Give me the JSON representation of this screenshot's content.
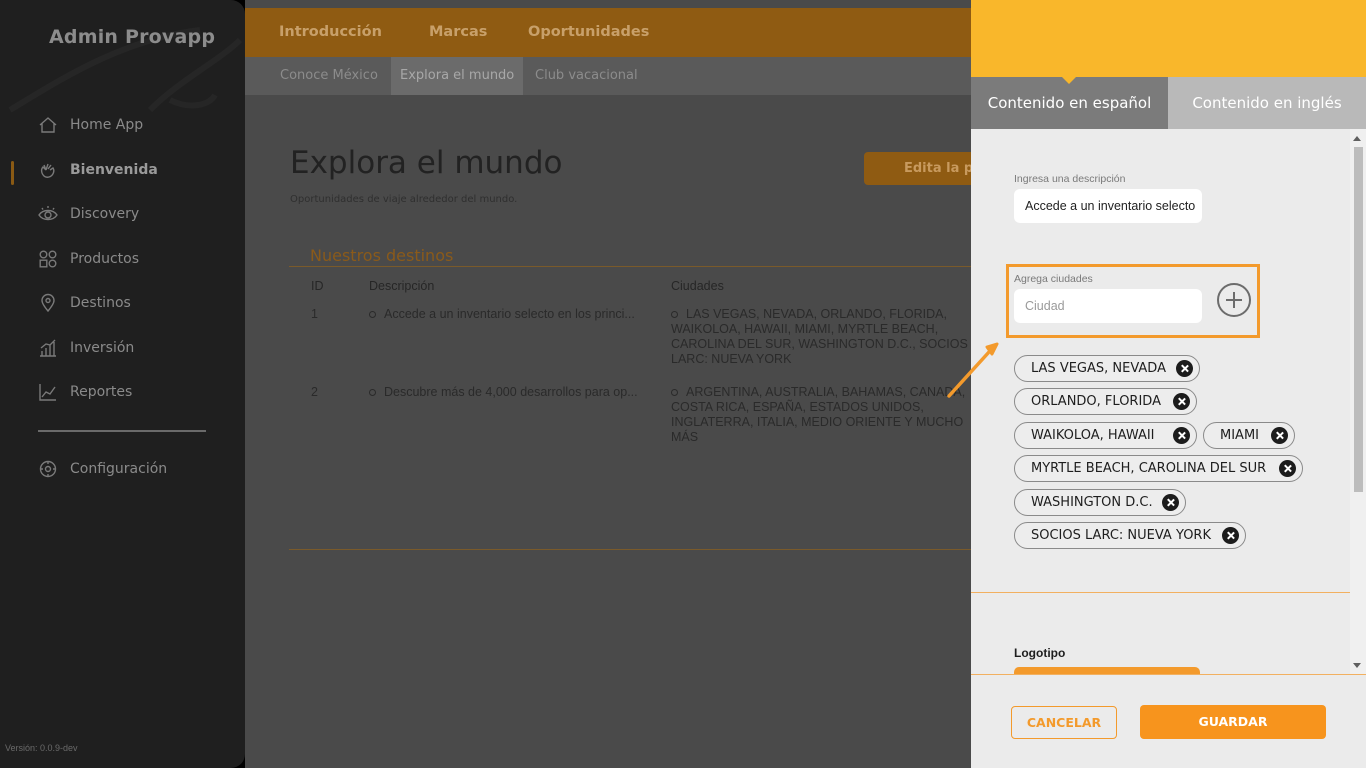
{
  "sidebar": {
    "brand": "Admin Provapp",
    "items": [
      {
        "label": "Home App",
        "icon": "home-icon"
      },
      {
        "label": "Bienvenida",
        "icon": "wave-hand-icon"
      },
      {
        "label": "Discovery",
        "icon": "eye-icon"
      },
      {
        "label": "Productos",
        "icon": "grid-icon"
      },
      {
        "label": "Destinos",
        "icon": "location-pin-icon"
      },
      {
        "label": "Inversión",
        "icon": "bar-chart-icon"
      },
      {
        "label": "Reportes",
        "icon": "line-chart-icon"
      }
    ],
    "settings_label": "Configuración",
    "version": "Versión: 0.0.9-dev"
  },
  "topnav": {
    "tabs": [
      "Introducción",
      "Marcas",
      "Oportunidades"
    ],
    "subtabs": [
      "Conoce México",
      "Explora el mundo",
      "Club vacacional"
    ]
  },
  "main": {
    "title": "Explora el mundo",
    "subtitle": "Oportunidades de viaje alrededor del mundo.",
    "edit_button": "Edita la po",
    "section_title": "Nuestros destinos",
    "table": {
      "headers": [
        "ID",
        "Descripción",
        "Ciudades"
      ],
      "rows": [
        {
          "id": "1",
          "desc": "Accede a un inventario selecto en los princi...",
          "cities": "LAS VEGAS, NEVADA, ORLANDO, FLORIDA, WAIKOLOA, HAWAII, MIAMI, MYRTLE BEACH, CAROLINA DEL SUR, WASHINGTON D.C., SOCIOS LARC: NUEVA YORK"
        },
        {
          "id": "2",
          "desc": "Descubre más de 4,000 desarrollos para op...",
          "cities": "ARGENTINA, AUSTRALIA, BAHAMAS, CANADÁ, COSTA RICA, ESPAÑA, ESTADOS UNIDOS, INGLATERRA, ITALIA, MEDIO ORIENTE Y MUCHO MÁS"
        }
      ]
    }
  },
  "panel": {
    "tab_es": "Contenido en español",
    "tab_en": "Contenido en inglés",
    "description_label": "Ingresa una descripción",
    "description_value": "Accede a un inventario selecto",
    "cities_label": "Agrega ciudades",
    "city_placeholder": "Ciudad",
    "chips": [
      "LAS VEGAS, NEVADA",
      "ORLANDO, FLORIDA",
      "WAIKOLOA, HAWAII",
      "MIAMI",
      "MYRTLE BEACH, CAROLINA DEL SUR",
      "WASHINGTON D.C.",
      "SOCIOS LARC: NUEVA YORK"
    ],
    "logo_label": "Logotipo",
    "cancel": "CANCELAR",
    "save": "GUARDAR"
  },
  "colors": {
    "accent": "#f39a2c",
    "header_yellow": "#f9b72b",
    "sidebar_bg": "#1f1f1f"
  }
}
